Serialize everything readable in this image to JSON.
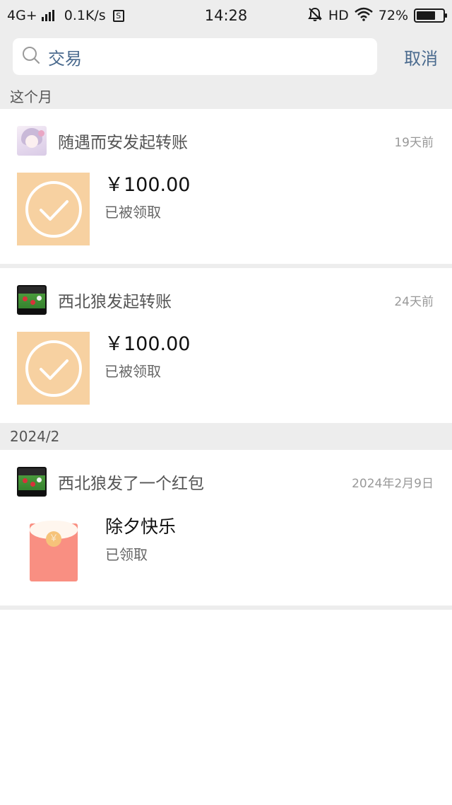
{
  "status_bar": {
    "network": "4G+",
    "speed": "0.1K/s",
    "sim_label": "S",
    "time": "14:28",
    "hd": "HD",
    "battery": "72%",
    "battery_level": 0.72
  },
  "search": {
    "query": "交易",
    "cancel_label": "取消"
  },
  "sections": [
    {
      "label": "这个月"
    },
    {
      "label": "2024/2"
    }
  ],
  "items": [
    {
      "title": "随遇而安发起转账",
      "time": "19天前",
      "amount": "￥100.00",
      "status": "已被领取"
    },
    {
      "title": "西北狼发起转账",
      "time": "24天前",
      "amount": "￥100.00",
      "status": "已被领取"
    },
    {
      "title": "西北狼发了一个红包",
      "time": "2024年2月9日",
      "message": "除夕快乐",
      "status": "已领取",
      "coin_symbol": "￥"
    }
  ],
  "colors": {
    "accent_text": "#4a6a8e",
    "transfer_icon_bg": "#f7d1a1",
    "red_packet": "#f98f82",
    "page_bg": "#ededed"
  }
}
